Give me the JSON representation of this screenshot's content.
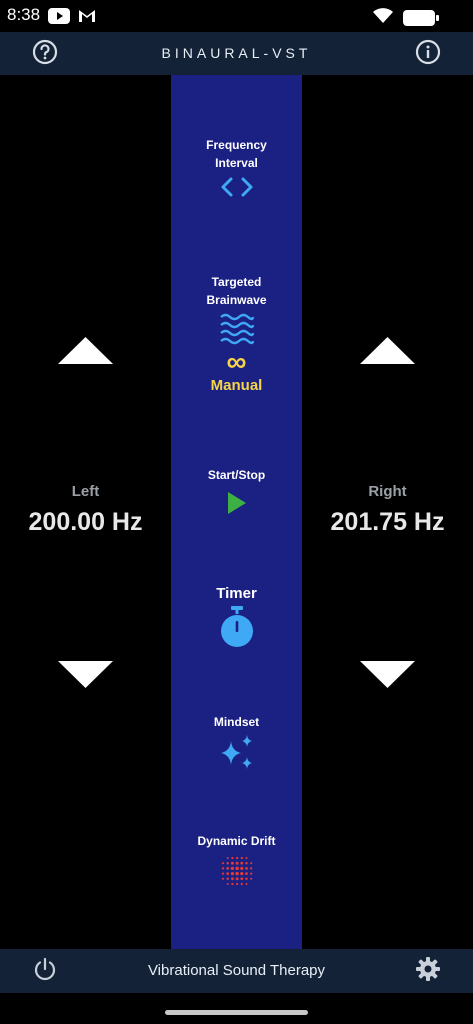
{
  "status_bar": {
    "time": "8:38",
    "icons_left": [
      "youtube-icon",
      "gmail-icon"
    ],
    "icons_right": [
      "wifi-icon",
      "battery-icon"
    ]
  },
  "header": {
    "title": "BINAURAL-VST",
    "help_icon": "question-circle-icon",
    "info_icon": "info-circle-icon"
  },
  "left": {
    "label": "Left",
    "value": "200.00 Hz"
  },
  "right": {
    "label": "Right",
    "value": "201.75 Hz"
  },
  "controls": {
    "frequency_interval": {
      "label_line1": "Frequency",
      "label_line2": "Interval",
      "icon": "code-brackets-icon"
    },
    "targeted_brainwave": {
      "label_line1": "Targeted",
      "label_line2": "Brainwave",
      "icon": "waves-icon",
      "mode_symbol": "∞",
      "mode": "Manual"
    },
    "start_stop": {
      "label": "Start/Stop",
      "icon": "play-icon"
    },
    "timer": {
      "label": "Timer",
      "icon": "stopwatch-icon"
    },
    "mindset": {
      "label": "Mindset",
      "icon": "sparkles-icon"
    },
    "dynamic_drift": {
      "label": "Dynamic Drift",
      "icon": "dot-pattern-icon"
    }
  },
  "bottom_bar": {
    "title": "Vibrational Sound Therapy",
    "power_icon": "power-icon",
    "settings_icon": "gear-icon"
  },
  "colors": {
    "center_column": "#1b2083",
    "header_bg": "#132236",
    "accent_blue": "#3fa9f5",
    "accent_yellow": "#f5d547",
    "play_green": "#3cb043",
    "drift_red": "#e53935"
  }
}
